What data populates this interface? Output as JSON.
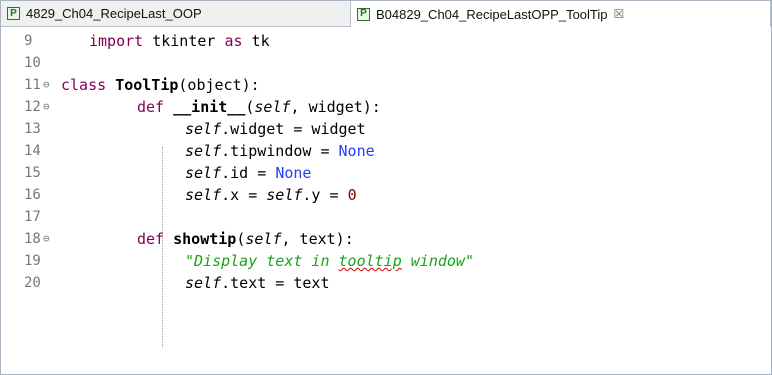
{
  "tabs": [
    {
      "label": "4829_Ch04_RecipeLast_OOP",
      "icon": "python-file-icon",
      "active": false
    },
    {
      "label": "B04829_Ch04_RecipeLastOPP_ToolTip",
      "icon": "python-file-icon",
      "active": true,
      "close": "☒"
    }
  ],
  "tab_icon_glyph": "P",
  "lines": [
    {
      "num": "9",
      "fold": "",
      "text": "import tkinter as tk"
    },
    {
      "num": "10",
      "fold": "",
      "text": ""
    },
    {
      "num": "11",
      "fold": "⊖",
      "text": "class ToolTip(object):"
    },
    {
      "num": "12",
      "fold": "⊖",
      "text": "def __init__(self, widget):"
    },
    {
      "num": "13",
      "fold": "",
      "text": "self.widget = widget"
    },
    {
      "num": "14",
      "fold": "",
      "text": "self.tipwindow = None"
    },
    {
      "num": "15",
      "fold": "",
      "text": "self.id = None"
    },
    {
      "num": "16",
      "fold": "",
      "text": "self.x = self.y = 0"
    },
    {
      "num": "17",
      "fold": "",
      "text": ""
    },
    {
      "num": "18",
      "fold": "⊖",
      "text": "def showtip(self, text):"
    },
    {
      "num": "19",
      "fold": "",
      "text": "\"Display text in tooltip window\""
    },
    {
      "num": "20",
      "fold": "",
      "text": "self.text = text"
    }
  ],
  "tokens": {
    "import": "import",
    "tkinter": "tkinter ",
    "as": "as",
    "tk": " tk",
    "class": "class",
    "ToolTip": "ToolTip",
    "object": "(object):",
    "def": "def",
    "init": "__init__",
    "init_args_open": "(",
    "self": "self",
    "init_args_rest": ", widget):",
    "widget_attr": ".widget = widget",
    "tipwindow_attr": ".tipwindow = ",
    "None": "None",
    "id_attr": ".id = ",
    "x_attr": ".x = ",
    "y_attr": ".y = ",
    "zero": "0",
    "showtip": "showtip",
    "showtip_args_rest": ", text):",
    "doc_start": "\"Display text in ",
    "doc_tooltip": "tooltip",
    "doc_end": " window\"",
    "text_attr": ".text = text"
  },
  "colors": {
    "keyword": "#7f0055",
    "constant": "#1f3fff",
    "string": "#1aa31a",
    "number": "#7f0000",
    "line_number": "#787878"
  }
}
